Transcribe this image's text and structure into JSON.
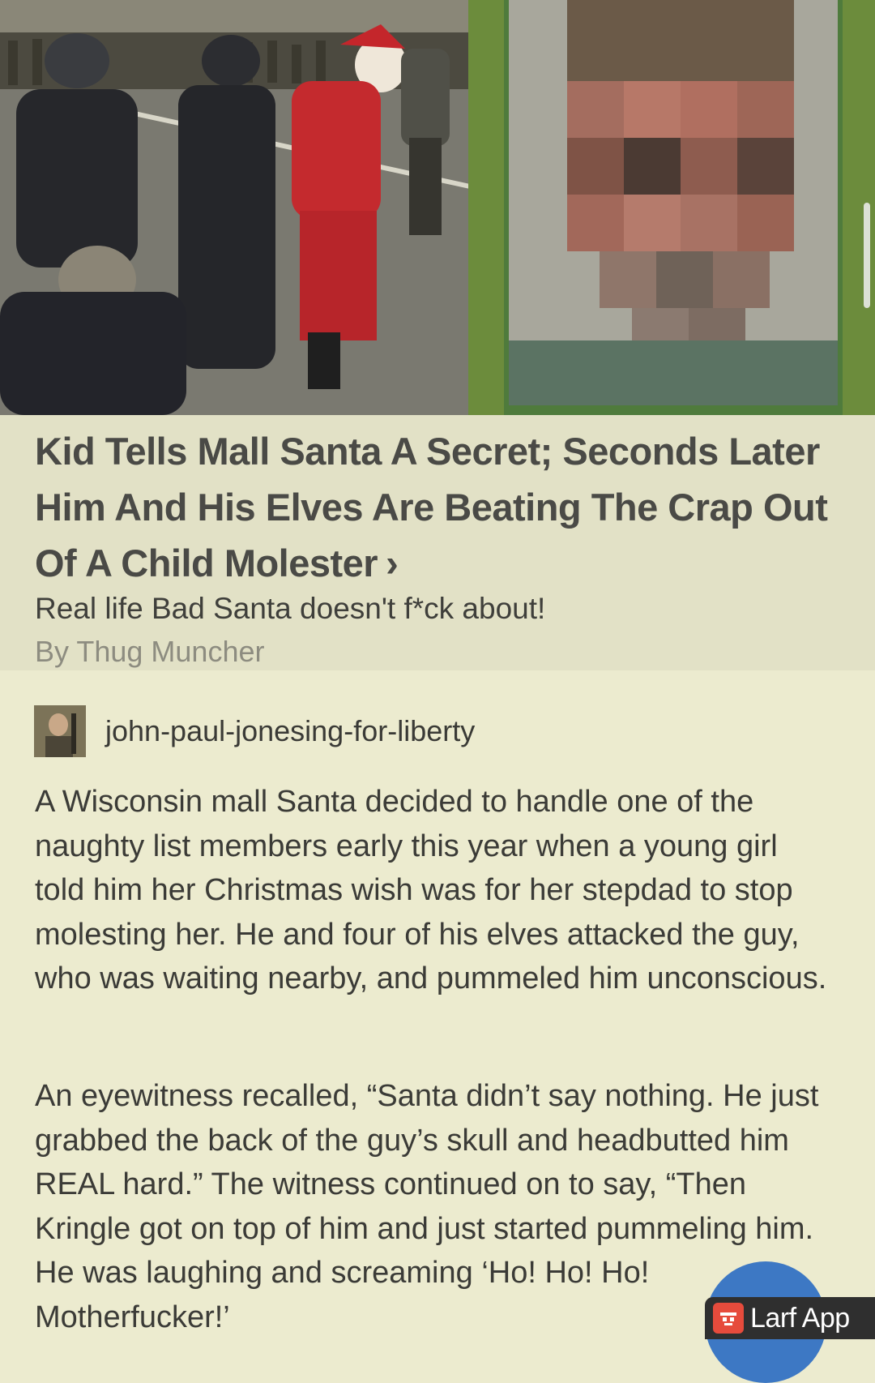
{
  "article": {
    "headline": "Kid Tells Mall Santa A Secret; Seconds Later Him And His Elves Are Beating The Crap Out Of A Child Molester",
    "chevron": "›",
    "subtitle": "Real life Bad Santa doesn't f*ck about!",
    "byline": "By Thug Muncher"
  },
  "post": {
    "username": "john-paul-jonesing-for-liberty",
    "paragraphs": [
      "A Wisconsin mall Santa decided to handle one of the naughty list members early this year when a young girl told him her Christmas wish was for her stepdad to stop molesting her. He and four of his elves attacked the guy, who was waiting nearby, and pummeled him unconscious.",
      "An eyewitness recalled, “Santa didn’t say nothing. He just grabbed the back of the guy’s skull and headbutted him REAL hard.” The witness continued on to say, “Then Kringle got on top of him and just started pummeling him. He was laughing and screaming ‘Ho! Ho! Ho! Motherfucker!’"
    ]
  },
  "watermark": {
    "label": "Larf App"
  },
  "colors": {
    "page_bg": "#ecebcf",
    "card_bg": "#e2e1c6",
    "headline": "#4a4a46",
    "byline": "#8d8c80",
    "badge_bg": "#2f2f2f",
    "badge_icon": "#e64b3c",
    "badge_circle": "#3d78c4"
  }
}
